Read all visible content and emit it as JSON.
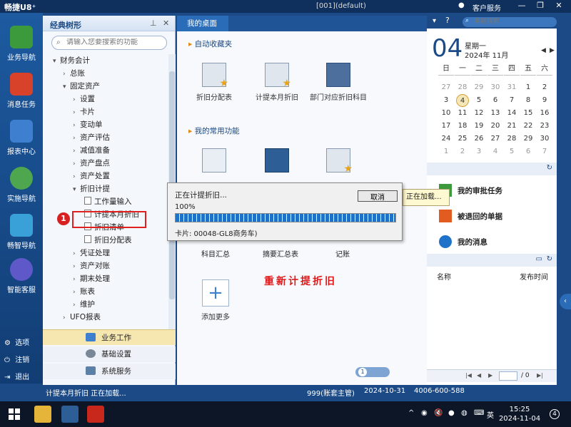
{
  "titlebar": {
    "logo": "畅捷U8⁺",
    "window_title": "[001](default)",
    "service": "客户服务",
    "minimize": "—",
    "restore": "❐",
    "close": "✕"
  },
  "leftnav": {
    "items": [
      {
        "label": "业务导航",
        "icon": "business-nav-icon"
      },
      {
        "label": "消息任务",
        "icon": "message-task-icon"
      },
      {
        "label": "报表中心",
        "icon": "report-center-icon"
      },
      {
        "label": "实施导航",
        "icon": "implement-nav-icon"
      },
      {
        "label": "畅智导航",
        "icon": "smart-nav-icon"
      },
      {
        "label": "智能客服",
        "icon": "smart-service-icon"
      }
    ],
    "bottom": [
      "选项",
      "注销",
      "退出"
    ]
  },
  "tree": {
    "title": "经典树形",
    "search_placeholder": "请输入您要搜索的功能",
    "nodes": [
      {
        "label": "财务会计",
        "arrow": "▾",
        "indent": 0
      },
      {
        "label": "总账",
        "arrow": "›",
        "indent": 1
      },
      {
        "label": "固定资产",
        "arrow": "▾",
        "indent": 1
      },
      {
        "label": "设置",
        "arrow": "›",
        "indent": 2
      },
      {
        "label": "卡片",
        "arrow": "›",
        "indent": 2
      },
      {
        "label": "变动单",
        "arrow": "›",
        "indent": 2
      },
      {
        "label": "资产评估",
        "arrow": "›",
        "indent": 2
      },
      {
        "label": "减值准备",
        "arrow": "›",
        "indent": 2
      },
      {
        "label": "资产盘点",
        "arrow": "›",
        "indent": 2
      },
      {
        "label": "资产处置",
        "arrow": "›",
        "indent": 2
      },
      {
        "label": "折旧计提",
        "arrow": "▾",
        "indent": 2
      },
      {
        "label": "工作量输入",
        "doc": true,
        "indent": 3
      },
      {
        "label": "计提本月折旧",
        "doc": true,
        "indent": 3
      },
      {
        "label": "折旧清单",
        "doc": true,
        "indent": 3
      },
      {
        "label": "折旧分配表",
        "doc": true,
        "indent": 3
      },
      {
        "label": "凭证处理",
        "arrow": "›",
        "indent": 2
      },
      {
        "label": "资产对账",
        "arrow": "›",
        "indent": 2
      },
      {
        "label": "期末处理",
        "arrow": "›",
        "indent": 2
      },
      {
        "label": "账表",
        "arrow": "›",
        "indent": 2
      },
      {
        "label": "维护",
        "arrow": "›",
        "indent": 2
      },
      {
        "label": "UFO报表",
        "arrow": "›",
        "indent": 1
      }
    ],
    "badge": "1",
    "modules": [
      "业务工作",
      "基础设置",
      "系统服务"
    ]
  },
  "main": {
    "tab": "我的桌面",
    "section_fav": "自动收藏夹",
    "section_common": "我的常用功能",
    "fav_tiles": [
      "折旧分配表",
      "计提本月折旧",
      "部门对应折旧科目"
    ],
    "common_tiles": [
      "科目汇总",
      "摘要汇总表",
      "记账"
    ],
    "add_more": "添加更多",
    "red_note": "重新计提折旧",
    "page": "1"
  },
  "dialog": {
    "title": "正在计提折旧...",
    "percent": "100%",
    "cancel": "取消",
    "card": "卡片: 00048-GL8商务车)",
    "progress": 1.0,
    "loading": "正在加载..."
  },
  "right": {
    "search_placeholder": "单据搜索",
    "day": "04",
    "weekday": "星期一",
    "year_month": "2024年 11月",
    "week_heads": [
      "日",
      "一",
      "二",
      "三",
      "四",
      "五",
      "六"
    ],
    "weeks": [
      [
        "27",
        "28",
        "29",
        "30",
        "31",
        "1",
        "2"
      ],
      [
        "3",
        "4",
        "5",
        "6",
        "7",
        "8",
        "9"
      ],
      [
        "10",
        "11",
        "12",
        "13",
        "14",
        "15",
        "16"
      ],
      [
        "17",
        "18",
        "19",
        "20",
        "21",
        "22",
        "23"
      ],
      [
        "24",
        "25",
        "26",
        "27",
        "28",
        "29",
        "30"
      ],
      [
        "1",
        "2",
        "3",
        "4",
        "5",
        "6",
        "7"
      ]
    ],
    "tasks": [
      "我的审批任务",
      "被退回的单据",
      "我的消息"
    ],
    "col_name": "名称",
    "col_time": "发布时间",
    "page_of": "/ 0"
  },
  "status": {
    "left": "计提本月折旧 正在加载...",
    "user": "999(账套主管)",
    "date": "2024-10-31",
    "phone": "4006-600-588"
  },
  "taskbar": {
    "ime": "英",
    "time": "15:25",
    "date": "2024-11-04",
    "notify": "4"
  },
  "colors": {
    "brand": "#1b4a86",
    "accent": "#2b6cb8",
    "highlight": "#e02020"
  }
}
